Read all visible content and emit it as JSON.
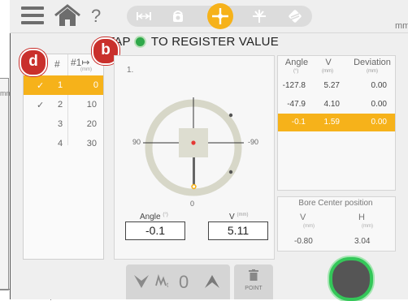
{
  "topbar": {
    "help_label": "?",
    "unit": "mm",
    "modes": [
      "range-icon",
      "sensor-icon",
      "crosshair-icon",
      "level-icon",
      "laser-icon"
    ],
    "active_mode_index": 2
  },
  "background_window": {
    "unit": "mm"
  },
  "instruction": {
    "prefix": "TAP",
    "suffix": "TO REGISTER VALUE"
  },
  "badges": {
    "d": "d",
    "b": "b"
  },
  "left_table": {
    "headers": {
      "hash": "#",
      "ref": "#1↦",
      "unit": "(mm)"
    },
    "rows": [
      {
        "check": "✓",
        "num": "1",
        "value": "0",
        "active": true
      },
      {
        "check": "✓",
        "num": "2",
        "value": "10",
        "active": false
      },
      {
        "check": "",
        "num": "3",
        "value": "20",
        "active": false
      },
      {
        "check": "",
        "num": "4",
        "value": "30",
        "active": false
      }
    ]
  },
  "measurement": {
    "point_number": "1.",
    "label_left": "90",
    "label_right": "-90",
    "label_bottom": "0",
    "angle_label": "Angle",
    "angle_unit": "(°)",
    "angle_value": "-0.1",
    "v_label": "V",
    "v_unit": "(mm)",
    "v_value": "5.11"
  },
  "right_table": {
    "headers": {
      "angle": "Angle",
      "angle_unit": "(°)",
      "v": "V",
      "v_unit": "(mm)",
      "deviation": "Deviation",
      "dev_unit": "(mm)"
    },
    "rows": [
      {
        "angle": "-127.8",
        "v": "5.27",
        "deviation": "0.00",
        "active": false
      },
      {
        "angle": "-47.9",
        "v": "4.10",
        "deviation": "0.00",
        "active": false
      },
      {
        "angle": "-0.1",
        "v": "1.59",
        "deviation": "0.00",
        "active": true
      }
    ]
  },
  "bore_center": {
    "title": "Bore Center position",
    "v_label": "V",
    "v_unit": "(mm)",
    "v_value": "-0.80",
    "h_label": "H",
    "h_unit": "(mm)",
    "h_value": "3.04"
  },
  "controls": {
    "zero_label": "0",
    "point_label": "POINT"
  },
  "colors": {
    "accent": "#f6b21a",
    "badge": "#c9302c",
    "register": "#34c759"
  }
}
